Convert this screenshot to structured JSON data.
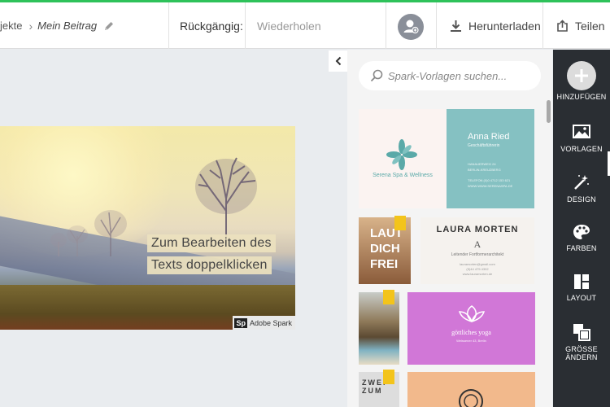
{
  "colors": {
    "accent_line": "#2ec25a",
    "rail_bg": "#2a2e33",
    "teal": "#85c1c2",
    "purple": "#d177d7",
    "tag": "#f3c41b"
  },
  "topbar": {
    "breadcrumb_prev": "jekte",
    "breadcrumb_sep": "›",
    "title": "Mein Beitrag",
    "undo_label": "Rückgängig:",
    "redo_label": "Wiederholen",
    "download_label": "Herunterladen",
    "share_label": "Teilen",
    "icons": {
      "edit": "pencil-icon",
      "avatar": "user-add-icon",
      "download": "download-icon",
      "share": "share-icon"
    }
  },
  "canvas": {
    "text_line1": "Zum Bearbeiten des",
    "text_line2": "Texts doppelklicken",
    "badge_logo": "Sp",
    "badge_text": "Adobe Spark"
  },
  "panel": {
    "search_placeholder": "Spark-Vorlagen suchen...",
    "templates": {
      "card1_brand": "Serena Spa & Wellness",
      "card1_name": "Anna Ried",
      "card1_role": "Geschäftsführerin",
      "card1_addr1": "HANAUERWEG 24",
      "card1_addr2": "BERLIN-KREUZBERG",
      "card1_addr3": "TELEFON (0)0 4712 153 621",
      "card1_addr4": "WWW.WWW.SERENASPA.DE",
      "card2_poster_l1": "LAUT",
      "card2_poster_l2": "DICH",
      "card2_poster_l3": "FREI",
      "card2_name": "LAURA MORTEN",
      "card2_initial": "A",
      "card2_role": "Leitender Fortformerarchitekt",
      "card2_addr1": "lauramorten@gmail.com",
      "card2_addr2": "(5)44 475 4302",
      "card2_addr3": "www.lauramorten.de",
      "card3_name": "göttliches yoga",
      "card3_addr": "Weissener 43, Berlin",
      "card4_poster": "ZWEI",
      "card4_poster2": "ZUM"
    }
  },
  "rail": {
    "items": [
      {
        "label": "HINZUFÜGEN",
        "icon": "plus-icon"
      },
      {
        "label": "VORLAGEN",
        "icon": "templates-icon",
        "active": true
      },
      {
        "label": "DESIGN",
        "icon": "magic-wand-icon"
      },
      {
        "label": "FARBEN",
        "icon": "palette-icon"
      },
      {
        "label": "LAYOUT",
        "icon": "layout-icon"
      },
      {
        "label": "GRÖSSE",
        "label2": "ÄNDERN",
        "icon": "resize-icon"
      }
    ]
  }
}
